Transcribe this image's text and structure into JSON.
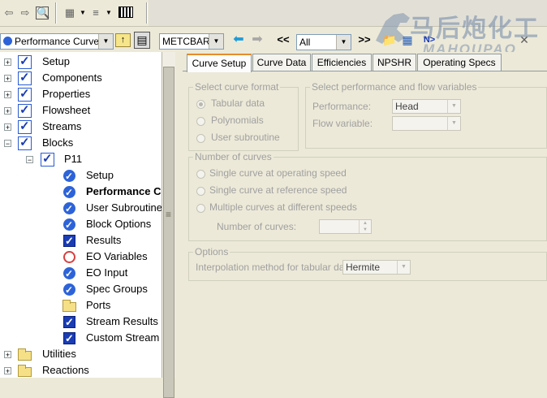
{
  "toolbar": {
    "form_select": "Performance Curves",
    "units_select": "METCBAR",
    "nav_prev_label": "<<",
    "nav_next_label": ">>",
    "filter_select": "All",
    "next_label": "N>"
  },
  "tree": {
    "items": [
      {
        "label": "Setup"
      },
      {
        "label": "Components"
      },
      {
        "label": "Properties"
      },
      {
        "label": "Flowsheet"
      },
      {
        "label": "Streams"
      },
      {
        "label": "Blocks"
      },
      {
        "label": "P11"
      },
      {
        "label": "Setup"
      },
      {
        "label": "Performance Cu"
      },
      {
        "label": "User Subroutine"
      },
      {
        "label": "Block Options"
      },
      {
        "label": "Results"
      },
      {
        "label": "EO Variables"
      },
      {
        "label": "EO Input"
      },
      {
        "label": "Spec Groups"
      },
      {
        "label": "Ports"
      },
      {
        "label": "Stream Results"
      },
      {
        "label": "Custom Stream"
      },
      {
        "label": "Utilities"
      },
      {
        "label": "Reactions"
      }
    ]
  },
  "tabs": [
    {
      "label": "Curve Setup"
    },
    {
      "label": "Curve Data"
    },
    {
      "label": "Efficiencies"
    },
    {
      "label": "NPSHR"
    },
    {
      "label": "Operating Specs"
    }
  ],
  "curve_format": {
    "title": "Select curve format",
    "options": [
      "Tabular data",
      "Polynomials",
      "User subroutine"
    ]
  },
  "perf_flow": {
    "title": "Select performance and flow variables",
    "performance_label": "Performance:",
    "performance_value": "Head",
    "flow_label": "Flow variable:",
    "flow_value": ""
  },
  "num_curves": {
    "title": "Number of curves",
    "options": [
      "Single curve at operating speed",
      "Single curve at reference speed",
      "Multiple curves at different speeds"
    ],
    "count_label": "Number of curves:"
  },
  "options": {
    "title": "Options",
    "interp_label": "Interpolation method for tabular data:",
    "interp_value": "Hermite"
  },
  "watermark": {
    "cn": "马后炮化工",
    "en": "MAHOUPAO"
  }
}
